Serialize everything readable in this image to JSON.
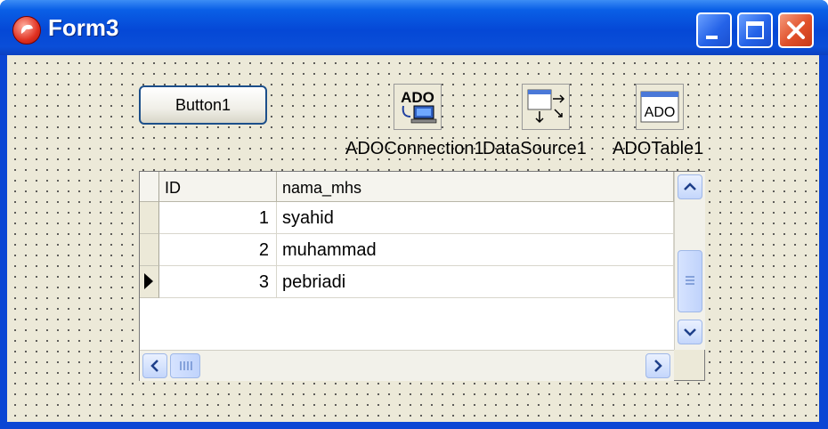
{
  "window": {
    "title": "Form3",
    "accent_color": "#0548d6",
    "controls": [
      "minimize",
      "maximize",
      "close"
    ]
  },
  "form": {
    "button1_label": "Button1",
    "components": [
      {
        "label": "ADOConnection1",
        "icon": "ado-connection-icon",
        "icon_text": "ADO"
      },
      {
        "label": "DataSource1",
        "icon": "datasource-icon"
      },
      {
        "label": "ADOTable1",
        "icon": "ado-table-icon",
        "icon_text": "ADO"
      }
    ]
  },
  "dbgrid": {
    "columns": [
      "ID",
      "nama_mhs"
    ],
    "rows": [
      {
        "id": "1",
        "nama_mhs": "syahid"
      },
      {
        "id": "2",
        "nama_mhs": "muhammad"
      },
      {
        "id": "3",
        "nama_mhs": "pebriadi"
      }
    ],
    "current_row": 3
  }
}
